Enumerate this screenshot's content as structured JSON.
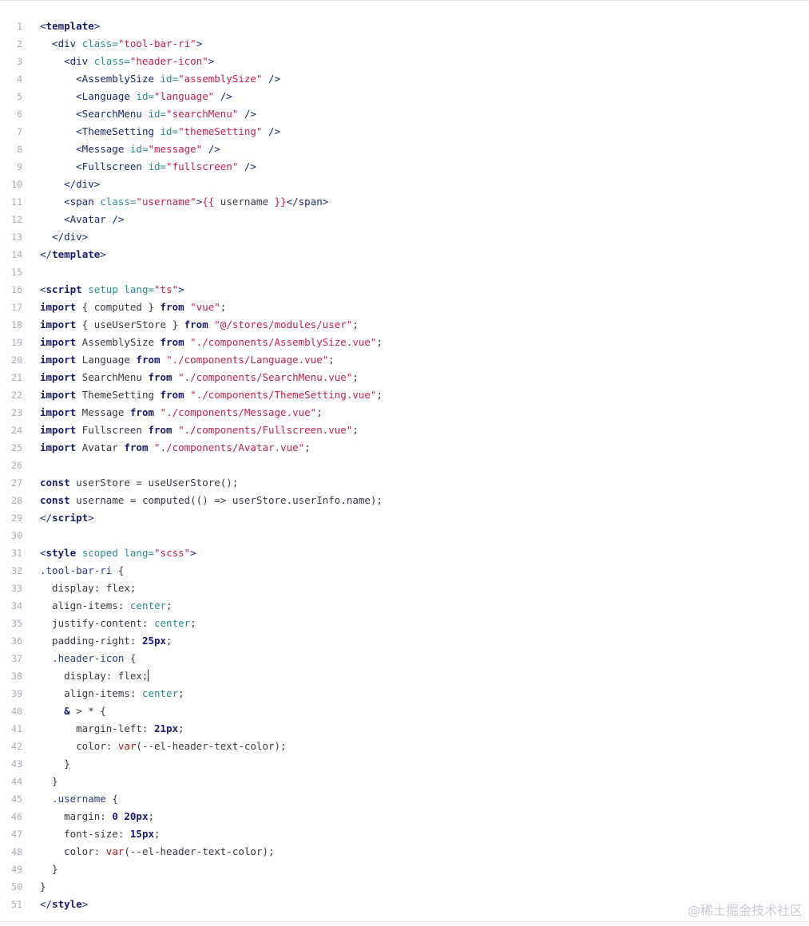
{
  "code_block": {
    "lines": [
      {
        "n": "1",
        "tokens": [
          [
            "t-tag",
            "<"
          ],
          [
            "t-kw",
            "template"
          ],
          [
            "t-tag",
            ">"
          ]
        ]
      },
      {
        "n": "2",
        "tokens": [
          [
            "t-plain",
            "  "
          ],
          [
            "t-tag",
            "<div "
          ],
          [
            "t-attr",
            "class="
          ],
          [
            "t-str",
            "\"tool-bar-ri\""
          ],
          [
            "t-tag",
            ">"
          ]
        ]
      },
      {
        "n": "3",
        "tokens": [
          [
            "t-plain",
            "    "
          ],
          [
            "t-tag",
            "<div "
          ],
          [
            "t-attr",
            "class="
          ],
          [
            "t-str",
            "\"header-icon\""
          ],
          [
            "t-tag",
            ">"
          ]
        ]
      },
      {
        "n": "4",
        "tokens": [
          [
            "t-plain",
            "      "
          ],
          [
            "t-tag",
            "<AssemblySize "
          ],
          [
            "t-attr",
            "id="
          ],
          [
            "t-str",
            "\"assemblySize\""
          ],
          [
            "t-tag",
            " />"
          ]
        ]
      },
      {
        "n": "5",
        "tokens": [
          [
            "t-plain",
            "      "
          ],
          [
            "t-tag",
            "<Language "
          ],
          [
            "t-attr",
            "id="
          ],
          [
            "t-str",
            "\"language\""
          ],
          [
            "t-tag",
            " />"
          ]
        ]
      },
      {
        "n": "6",
        "tokens": [
          [
            "t-plain",
            "      "
          ],
          [
            "t-tag",
            "<SearchMenu "
          ],
          [
            "t-attr",
            "id="
          ],
          [
            "t-str",
            "\"searchMenu\""
          ],
          [
            "t-tag",
            " />"
          ]
        ]
      },
      {
        "n": "7",
        "tokens": [
          [
            "t-plain",
            "      "
          ],
          [
            "t-tag",
            "<ThemeSetting "
          ],
          [
            "t-attr",
            "id="
          ],
          [
            "t-str",
            "\"themeSetting\""
          ],
          [
            "t-tag",
            " />"
          ]
        ]
      },
      {
        "n": "8",
        "tokens": [
          [
            "t-plain",
            "      "
          ],
          [
            "t-tag",
            "<Message "
          ],
          [
            "t-attr",
            "id="
          ],
          [
            "t-str",
            "\"message\""
          ],
          [
            "t-tag",
            " />"
          ]
        ]
      },
      {
        "n": "9",
        "tokens": [
          [
            "t-plain",
            "      "
          ],
          [
            "t-tag",
            "<Fullscreen "
          ],
          [
            "t-attr",
            "id="
          ],
          [
            "t-str",
            "\"fullscreen\""
          ],
          [
            "t-tag",
            " />"
          ]
        ]
      },
      {
        "n": "10",
        "tokens": [
          [
            "t-plain",
            "    "
          ],
          [
            "t-tag",
            "</div>"
          ]
        ]
      },
      {
        "n": "11",
        "tokens": [
          [
            "t-plain",
            "    "
          ],
          [
            "t-tag",
            "<span "
          ],
          [
            "t-attr",
            "class="
          ],
          [
            "t-str",
            "\"username\""
          ],
          [
            "t-tag",
            ">"
          ],
          [
            "t-str",
            "{{"
          ],
          [
            "t-plain",
            " username "
          ],
          [
            "t-str",
            "}}"
          ],
          [
            "t-tag",
            "</span>"
          ]
        ]
      },
      {
        "n": "12",
        "tokens": [
          [
            "t-plain",
            "    "
          ],
          [
            "t-tag",
            "<Avatar />"
          ]
        ]
      },
      {
        "n": "13",
        "tokens": [
          [
            "t-plain",
            "  "
          ],
          [
            "t-tag",
            "</div>"
          ]
        ]
      },
      {
        "n": "14",
        "tokens": [
          [
            "t-tag",
            "</"
          ],
          [
            "t-kw",
            "template"
          ],
          [
            "t-tag",
            ">"
          ]
        ]
      },
      {
        "n": "15",
        "tokens": []
      },
      {
        "n": "16",
        "tokens": [
          [
            "t-tag",
            "<"
          ],
          [
            "t-kw",
            "script"
          ],
          [
            "t-attr",
            " setup lang="
          ],
          [
            "t-str",
            "\"ts\""
          ],
          [
            "t-tag",
            ">"
          ]
        ]
      },
      {
        "n": "17",
        "tokens": [
          [
            "t-kw",
            "import"
          ],
          [
            "t-plain",
            " { computed } "
          ],
          [
            "t-kw",
            "from"
          ],
          [
            "t-plain",
            " "
          ],
          [
            "t-str",
            "\"vue\""
          ],
          [
            "t-plain",
            ";"
          ]
        ]
      },
      {
        "n": "18",
        "tokens": [
          [
            "t-kw",
            "import"
          ],
          [
            "t-plain",
            " { useUserStore } "
          ],
          [
            "t-kw",
            "from"
          ],
          [
            "t-plain",
            " "
          ],
          [
            "t-str",
            "\"@/stores/modules/user\""
          ],
          [
            "t-plain",
            ";"
          ]
        ]
      },
      {
        "n": "19",
        "tokens": [
          [
            "t-kw",
            "import"
          ],
          [
            "t-plain",
            " AssemblySize "
          ],
          [
            "t-kw",
            "from"
          ],
          [
            "t-plain",
            " "
          ],
          [
            "t-str",
            "\"./components/AssemblySize.vue\""
          ],
          [
            "t-plain",
            ";"
          ]
        ]
      },
      {
        "n": "20",
        "tokens": [
          [
            "t-kw",
            "import"
          ],
          [
            "t-plain",
            " Language "
          ],
          [
            "t-kw",
            "from"
          ],
          [
            "t-plain",
            " "
          ],
          [
            "t-str",
            "\"./components/Language.vue\""
          ],
          [
            "t-plain",
            ";"
          ]
        ]
      },
      {
        "n": "21",
        "tokens": [
          [
            "t-kw",
            "import"
          ],
          [
            "t-plain",
            " SearchMenu "
          ],
          [
            "t-kw",
            "from"
          ],
          [
            "t-plain",
            " "
          ],
          [
            "t-str",
            "\"./components/SearchMenu.vue\""
          ],
          [
            "t-plain",
            ";"
          ]
        ]
      },
      {
        "n": "22",
        "tokens": [
          [
            "t-kw",
            "import"
          ],
          [
            "t-plain",
            " ThemeSetting "
          ],
          [
            "t-kw",
            "from"
          ],
          [
            "t-plain",
            " "
          ],
          [
            "t-str",
            "\"./components/ThemeSetting.vue\""
          ],
          [
            "t-plain",
            ";"
          ]
        ]
      },
      {
        "n": "23",
        "tokens": [
          [
            "t-kw",
            "import"
          ],
          [
            "t-plain",
            " Message "
          ],
          [
            "t-kw",
            "from"
          ],
          [
            "t-plain",
            " "
          ],
          [
            "t-str",
            "\"./components/Message.vue\""
          ],
          [
            "t-plain",
            ";"
          ]
        ]
      },
      {
        "n": "24",
        "tokens": [
          [
            "t-kw",
            "import"
          ],
          [
            "t-plain",
            " Fullscreen "
          ],
          [
            "t-kw",
            "from"
          ],
          [
            "t-plain",
            " "
          ],
          [
            "t-str",
            "\"./components/Fullscreen.vue\""
          ],
          [
            "t-plain",
            ";"
          ]
        ]
      },
      {
        "n": "25",
        "tokens": [
          [
            "t-kw",
            "import"
          ],
          [
            "t-plain",
            " Avatar "
          ],
          [
            "t-kw",
            "from"
          ],
          [
            "t-plain",
            " "
          ],
          [
            "t-str",
            "\"./components/Avatar.vue\""
          ],
          [
            "t-plain",
            ";"
          ]
        ]
      },
      {
        "n": "26",
        "tokens": []
      },
      {
        "n": "27",
        "tokens": [
          [
            "t-kw",
            "const"
          ],
          [
            "t-plain",
            " userStore = useUserStore();"
          ]
        ]
      },
      {
        "n": "28",
        "tokens": [
          [
            "t-kw",
            "const"
          ],
          [
            "t-plain",
            " username = computed(() => userStore.userInfo.name);"
          ]
        ]
      },
      {
        "n": "29",
        "tokens": [
          [
            "t-tag",
            "</"
          ],
          [
            "t-kw",
            "script"
          ],
          [
            "t-tag",
            ">"
          ]
        ]
      },
      {
        "n": "30",
        "tokens": []
      },
      {
        "n": "31",
        "tokens": [
          [
            "t-tag",
            "<"
          ],
          [
            "t-kw",
            "style"
          ],
          [
            "t-attr",
            " scoped lang="
          ],
          [
            "t-str",
            "\"scss\""
          ],
          [
            "t-tag",
            ">"
          ]
        ]
      },
      {
        "n": "32",
        "tokens": [
          [
            "t-sel",
            ".tool-bar-ri"
          ],
          [
            "t-plain",
            " {"
          ]
        ]
      },
      {
        "n": "33",
        "tokens": [
          [
            "t-plain",
            "  display: flex;"
          ]
        ]
      },
      {
        "n": "34",
        "tokens": [
          [
            "t-plain",
            "  align-items: "
          ],
          [
            "t-val",
            "center"
          ],
          [
            "t-plain",
            ";"
          ]
        ]
      },
      {
        "n": "35",
        "tokens": [
          [
            "t-plain",
            "  justify-content: "
          ],
          [
            "t-val",
            "center"
          ],
          [
            "t-plain",
            ";"
          ]
        ]
      },
      {
        "n": "36",
        "tokens": [
          [
            "t-plain",
            "  padding-right: "
          ],
          [
            "t-num",
            "25px"
          ],
          [
            "t-plain",
            ";"
          ]
        ]
      },
      {
        "n": "37",
        "tokens": [
          [
            "t-plain",
            "  "
          ],
          [
            "t-sel",
            ".header-icon"
          ],
          [
            "t-plain",
            " {"
          ]
        ]
      },
      {
        "n": "38",
        "tokens": [
          [
            "t-plain",
            "    display: flex;"
          ],
          [
            "t-caret",
            ""
          ]
        ]
      },
      {
        "n": "39",
        "tokens": [
          [
            "t-plain",
            "    align-items: "
          ],
          [
            "t-val",
            "center"
          ],
          [
            "t-plain",
            ";"
          ]
        ]
      },
      {
        "n": "40",
        "tokens": [
          [
            "t-plain",
            "    "
          ],
          [
            "t-kw",
            "&"
          ],
          [
            "t-plain",
            " > * {"
          ]
        ]
      },
      {
        "n": "41",
        "tokens": [
          [
            "t-plain",
            "      margin-left: "
          ],
          [
            "t-num",
            "21px"
          ],
          [
            "t-plain",
            ";"
          ]
        ]
      },
      {
        "n": "42",
        "tokens": [
          [
            "t-plain",
            "      color: "
          ],
          [
            "t-fn",
            "var"
          ],
          [
            "t-plain",
            "(--el-header-text-color);"
          ]
        ]
      },
      {
        "n": "43",
        "tokens": [
          [
            "t-plain",
            "    }"
          ]
        ]
      },
      {
        "n": "44",
        "tokens": [
          [
            "t-plain",
            "  }"
          ]
        ]
      },
      {
        "n": "45",
        "tokens": [
          [
            "t-plain",
            "  "
          ],
          [
            "t-sel",
            ".username"
          ],
          [
            "t-plain",
            " {"
          ]
        ]
      },
      {
        "n": "46",
        "tokens": [
          [
            "t-plain",
            "    margin: "
          ],
          [
            "t-num",
            "0 20px"
          ],
          [
            "t-plain",
            ";"
          ]
        ]
      },
      {
        "n": "47",
        "tokens": [
          [
            "t-plain",
            "    font-size: "
          ],
          [
            "t-num",
            "15px"
          ],
          [
            "t-plain",
            ";"
          ]
        ]
      },
      {
        "n": "48",
        "tokens": [
          [
            "t-plain",
            "    color: "
          ],
          [
            "t-fn",
            "var"
          ],
          [
            "t-plain",
            "(--el-header-text-color);"
          ]
        ]
      },
      {
        "n": "49",
        "tokens": [
          [
            "t-plain",
            "  }"
          ]
        ]
      },
      {
        "n": "50",
        "tokens": [
          [
            "t-plain",
            "}"
          ]
        ]
      },
      {
        "n": "51",
        "tokens": [
          [
            "t-tag",
            "</"
          ],
          [
            "t-kw",
            "style"
          ],
          [
            "t-tag",
            ">"
          ]
        ]
      }
    ]
  },
  "watermark": {
    "text": "@稀土掘金技术社区"
  }
}
